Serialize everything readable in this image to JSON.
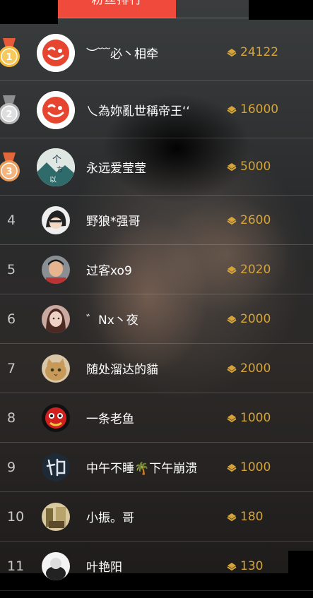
{
  "header": {
    "title": "粉丝排行"
  },
  "colors": {
    "accent": "#f04a3c",
    "score": "#d6a436"
  },
  "ranking": [
    {
      "rank": "1",
      "name": "︶﹋必丶相牵",
      "score": "24122",
      "medal": "gold",
      "avatar": "weibo-logo-icon"
    },
    {
      "rank": "2",
      "name": "乀為妳亂世稱帝王‘‘",
      "score": "16000",
      "medal": "silver",
      "avatar": "weibo-logo-icon"
    },
    {
      "rank": "3",
      "name": "永远爱莹莹",
      "score": "5000",
      "medal": "bronze",
      "avatar": "landscape-avatar-icon"
    },
    {
      "rank": "4",
      "name": "野狼*强哥",
      "score": "2600",
      "avatar": "cartoon-avatar-icon"
    },
    {
      "rank": "5",
      "name": "过客xo9",
      "score": "2020",
      "avatar": "boy-avatar-icon"
    },
    {
      "rank": "6",
      "name": "゛Nx丶夜",
      "score": "2000",
      "avatar": "girl-avatar-icon"
    },
    {
      "rank": "7",
      "name": "随处溜达的貓",
      "score": "2000",
      "avatar": "cat-avatar-icon"
    },
    {
      "rank": "8",
      "name": "一条老鱼",
      "score": "1000",
      "avatar": "lion-dance-avatar-icon"
    },
    {
      "rank": "9",
      "name": "中午不睡🌴下午崩溃",
      "score": "1000",
      "avatar": "calligraphy-avatar-icon"
    },
    {
      "rank": "10",
      "name": "小振。哥",
      "score": "180",
      "avatar": "photo-avatar-icon"
    },
    {
      "rank": "11",
      "name": "叶艳阳",
      "score": "130",
      "avatar": "white-avatar-icon"
    }
  ]
}
